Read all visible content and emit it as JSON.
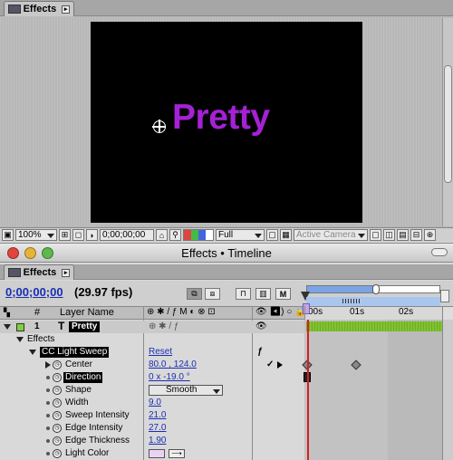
{
  "comp_window": {
    "tab_label": "Effects",
    "text_layer": "Pretty",
    "text_color": "#a521d6",
    "toolbar": {
      "zoom": "100%",
      "timecode": "0;00;00;00",
      "resolution": "Full",
      "camera": "Active Camera"
    }
  },
  "timeline_window": {
    "title": "Effects • Timeline",
    "tab_label": "Effects",
    "current_time": "0;00;00;00",
    "fps": "(29.97 fps)",
    "ruler": [
      "00s",
      "01s",
      "02s"
    ],
    "column_headers": {
      "num": "#",
      "layer_name": "Layer Name",
      "switches": "⊕ ✱ / ƒ M ◐ ⊗ ⊡",
      "av": "👁 ◀) ○ 🔒"
    },
    "layers": [
      {
        "number": "1",
        "name": "Pretty",
        "label_color": "#7fd13b"
      }
    ],
    "effects_group": "Effects",
    "effect": {
      "name": "CC Light Sweep",
      "reset": "Reset"
    },
    "properties": [
      {
        "name": "Center",
        "value": "80.0 , 124.0"
      },
      {
        "name": "Direction",
        "value": "0 x -19.0 °"
      },
      {
        "name": "Shape",
        "value": "Smooth"
      },
      {
        "name": "Width",
        "value": "9.0"
      },
      {
        "name": "Sweep Intensity",
        "value": "21.0"
      },
      {
        "name": "Edge Intensity",
        "value": "27.0"
      },
      {
        "name": "Edge Thickness",
        "value": "1.90"
      },
      {
        "name": "Light Color",
        "value": ""
      }
    ],
    "light_color_swatch": "#e9d3f2"
  }
}
